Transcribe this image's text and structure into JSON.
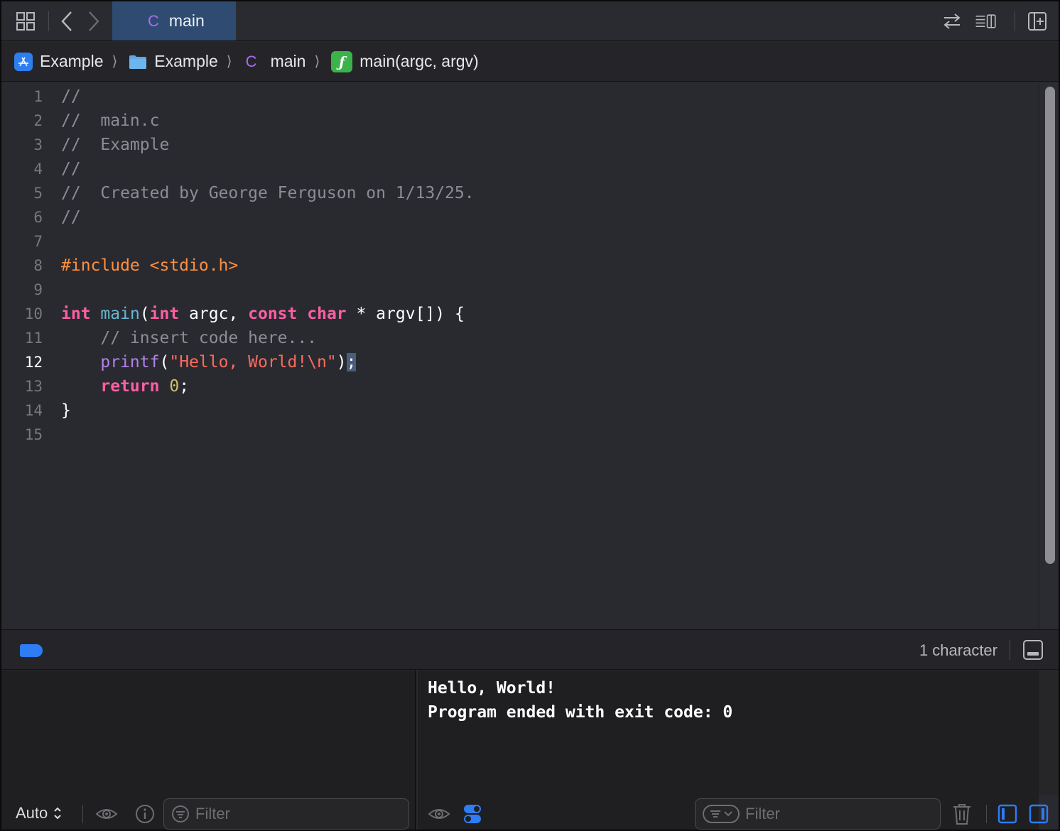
{
  "tabbar": {
    "active_tab": {
      "icon": "c-file-icon",
      "label": "main",
      "glyph": "C"
    }
  },
  "jumpbar": {
    "crumbs": [
      {
        "icon": "xcode-project-icon",
        "label": "Example"
      },
      {
        "icon": "folder-icon",
        "label": "Example"
      },
      {
        "icon": "c-file-icon",
        "label": "main",
        "glyph": "C"
      },
      {
        "icon": "function-icon",
        "label": "main(argc, argv)",
        "glyph": "ƒ"
      }
    ],
    "separator": "⟩"
  },
  "editor": {
    "current_line": 12,
    "line_numbers": [
      "1",
      "2",
      "3",
      "4",
      "5",
      "6",
      "7",
      "8",
      "9",
      "10",
      "11",
      "12",
      "13",
      "14",
      "15"
    ],
    "lines": {
      "l1": "//",
      "l2": "//  main.c",
      "l3": "//  Example",
      "l4": "//",
      "l5": "//  Created by George Ferguson on 1/13/25.",
      "l6": "//",
      "l8a": "#include ",
      "l8b": "<stdio.h>",
      "l10_int": "int",
      "l10_main": "main",
      "l10_paren": "(",
      "l10_int2": "int",
      "l10_argc": " argc, ",
      "l10_const": "const",
      "l10_sp": " ",
      "l10_char": "char",
      "l10_rest": " * argv[]) {",
      "l11": "    // insert code here...",
      "l12_indent": "    ",
      "l12_printf": "printf",
      "l12_open": "(",
      "l12_str": "\"Hello, World!\\n\"",
      "l12_close": ")",
      "l12_semi": ";",
      "l13_indent": "    ",
      "l13_return": "return",
      "l13_sp": " ",
      "l13_zero": "0",
      "l13_semi": ";",
      "l14": "}"
    }
  },
  "debugbar": {
    "selection_count": "1 character"
  },
  "variables": {
    "scope_select": "Auto",
    "filter_placeholder": "Filter"
  },
  "console": {
    "output_line1": "Hello, World!",
    "output_line2": "Program ended with exit code: 0",
    "filter_placeholder": "Filter"
  },
  "colors": {
    "accent": "#2e7cf6",
    "active_tab": "#2f4b71",
    "keyword": "#fc5fa3",
    "string": "#fc6a5d",
    "comment": "#8a8e94",
    "preprocessor": "#fd8f3f",
    "number": "#d0bf69",
    "function_call": "#b281eb",
    "function_decl": "#67b7d1"
  }
}
